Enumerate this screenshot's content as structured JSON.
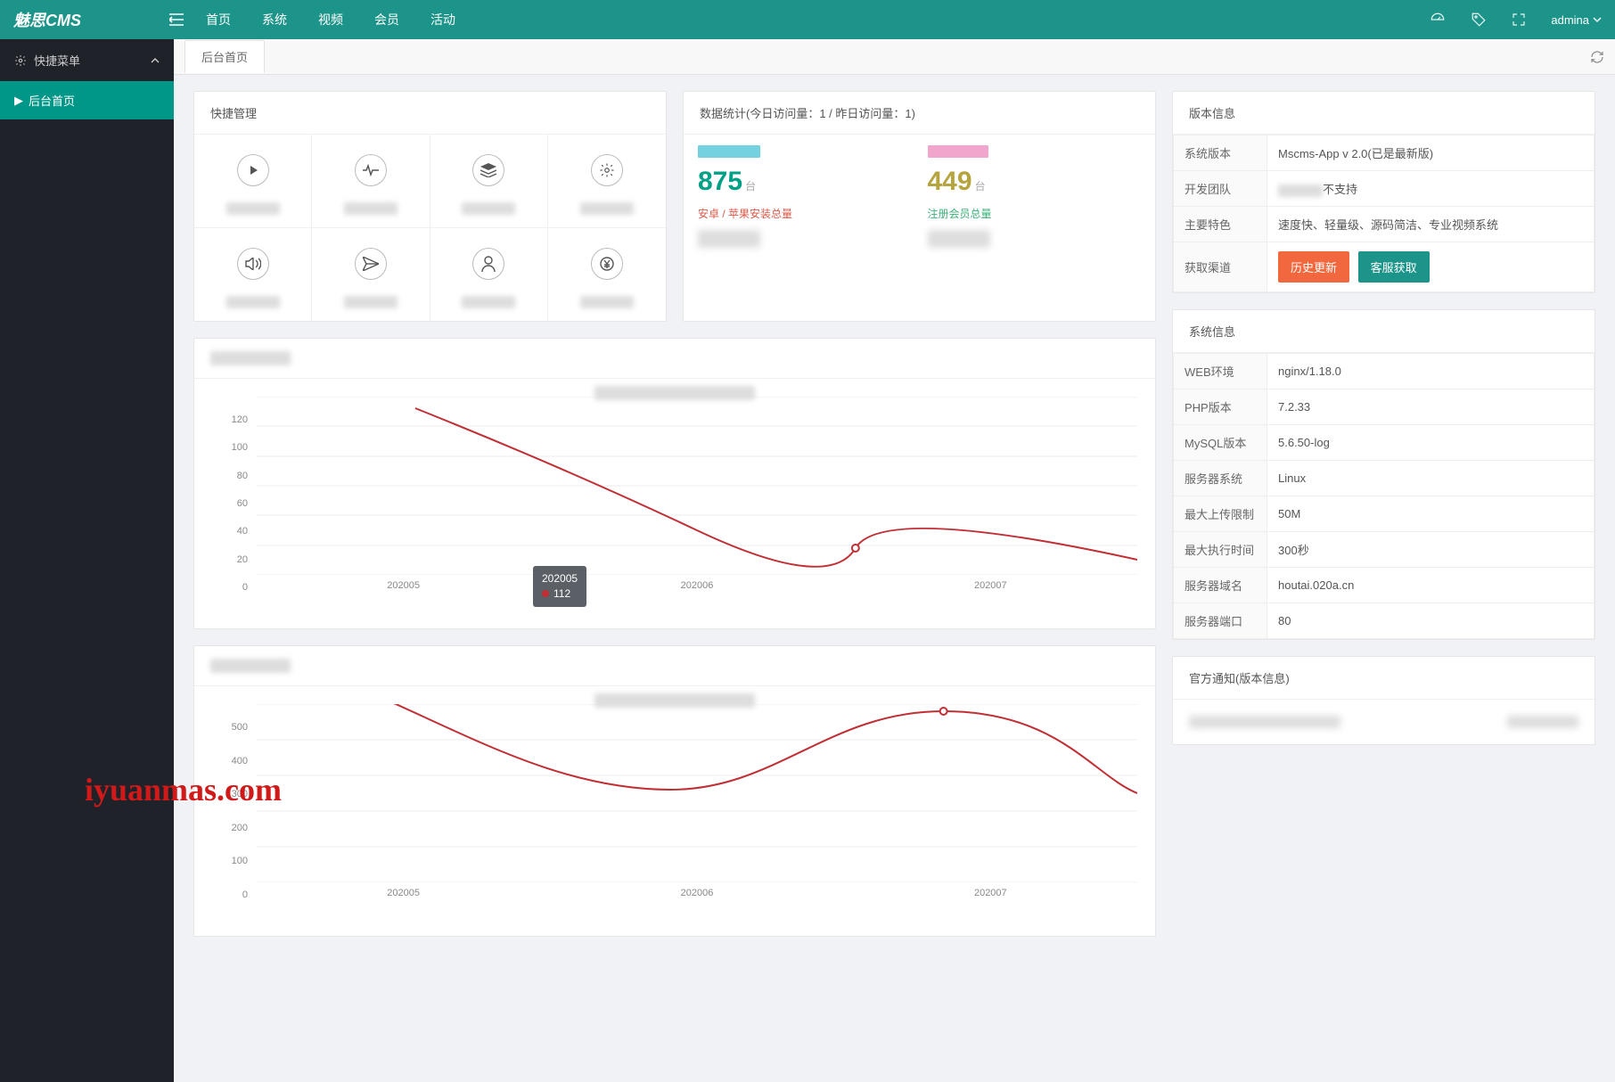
{
  "brand": "魅思CMS",
  "topnav": [
    "首页",
    "系统",
    "视频",
    "会员",
    "活动"
  ],
  "user": "admina",
  "sidebar": {
    "group": "快捷菜单",
    "item": "后台首页"
  },
  "tab": "后台首页",
  "quick": {
    "title": "快捷管理"
  },
  "stats": {
    "title": "数据统计(今日访问量：1 / 昨日访问量：1)",
    "left": {
      "num": "875",
      "unit": "台",
      "sub": "安卓 / 苹果安装总量"
    },
    "right": {
      "num": "449",
      "unit": "台",
      "sub": "注册会员总量"
    }
  },
  "version": {
    "title": "版本信息",
    "rows": {
      "r1k": "系统版本",
      "r1v": "Mscms-App v 2.0(已是最新版)",
      "r2k": "开发团队",
      "r2v_suffix": "不支持",
      "r3k": "主要特色",
      "r3v": "速度快、轻量级、源码简洁、专业视频系统",
      "r4k": "获取渠道",
      "b1": "历史更新",
      "b2": "客服获取"
    }
  },
  "sysinfo": {
    "title": "系统信息",
    "rows": [
      [
        "WEB环境",
        "nginx/1.18.0"
      ],
      [
        "PHP版本",
        "7.2.33"
      ],
      [
        "MySQL版本",
        "5.6.50-log"
      ],
      [
        "服务器系统",
        "Linux"
      ],
      [
        "最大上传限制",
        "50M"
      ],
      [
        "最大执行时间",
        "300秒"
      ],
      [
        "服务器域名",
        "houtai.020a.cn"
      ],
      [
        "服务器端口",
        "80"
      ]
    ]
  },
  "notice": {
    "title": "官方通知(版本信息)"
  },
  "watermark": "iyuanmas.com",
  "chart_data": [
    {
      "type": "line",
      "categories": [
        "202005",
        "202006",
        "202007"
      ],
      "values": [
        112,
        18,
        10
      ],
      "ylim": [
        0,
        120
      ],
      "yticks": [
        0,
        20,
        40,
        60,
        80,
        100,
        120
      ],
      "tooltip": {
        "label": "202005",
        "value": "112"
      }
    },
    {
      "type": "line",
      "categories": [
        "202005",
        "202006",
        "202007"
      ],
      "values": [
        520,
        260,
        480,
        250
      ],
      "ylim": [
        0,
        500
      ],
      "yticks": [
        0,
        100,
        200,
        300,
        400,
        500
      ]
    }
  ]
}
